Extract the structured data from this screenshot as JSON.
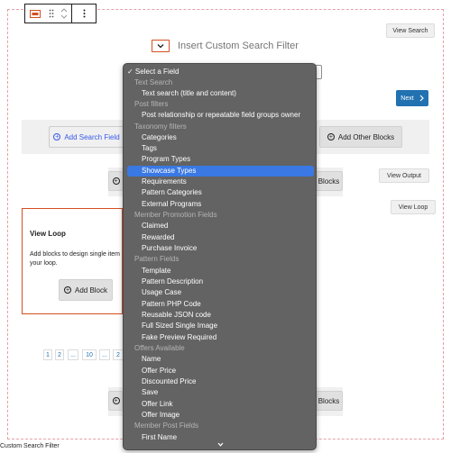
{
  "toolbar": {
    "block_icon": "custom-search-filter-icon",
    "drag_icon": "drag-handle-icon",
    "move_icon": "move-up-down-icon",
    "options_icon": "more-options-icon"
  },
  "header": {
    "title": "Insert Custom Search Filter",
    "collapse_icon": "chevron-down-icon"
  },
  "buttons": {
    "view_search": "View Search",
    "next": "Next",
    "view_output": "View Output",
    "view_loop": "View Loop",
    "add_search_field": "Add Search Field",
    "add_other_blocks": "Add Other Blocks",
    "blocks_fragment": "Blocks",
    "add_block": "Add Block"
  },
  "view_loop_panel": {
    "title": "View Loop",
    "description": "Add blocks to design single item in your loop.",
    "line1": "Add blocks to design single item",
    "line2": "your loop."
  },
  "pagination": [
    "1",
    "2",
    "...",
    "10",
    "...",
    "2"
  ],
  "footer": {
    "breadcrumb": "Custom Search Filter"
  },
  "dropdown": {
    "items": [
      {
        "type": "selected",
        "label": "✓ Select a Field"
      },
      {
        "type": "group",
        "label": "Text Search"
      },
      {
        "type": "option",
        "label": "Text search (title and content)"
      },
      {
        "type": "group",
        "label": "Post filters"
      },
      {
        "type": "option",
        "label": "Post relationship or repeatable field groups owner"
      },
      {
        "type": "group",
        "label": "Taxonomy filters"
      },
      {
        "type": "option",
        "label": "Categories"
      },
      {
        "type": "option",
        "label": "Tags"
      },
      {
        "type": "option",
        "label": "Program Types"
      },
      {
        "type": "highlight",
        "label": "Showcase Types"
      },
      {
        "type": "option",
        "label": "Requirements"
      },
      {
        "type": "option",
        "label": "Pattern Categories"
      },
      {
        "type": "option",
        "label": "External Programs"
      },
      {
        "type": "group",
        "label": "Member Promotion Fields"
      },
      {
        "type": "option",
        "label": "Claimed"
      },
      {
        "type": "option",
        "label": "Rewarded"
      },
      {
        "type": "option",
        "label": "Purchase Invoice"
      },
      {
        "type": "group",
        "label": "Pattern Fields"
      },
      {
        "type": "option",
        "label": "Template"
      },
      {
        "type": "option",
        "label": "Pattern Description"
      },
      {
        "type": "option",
        "label": "Usage Case"
      },
      {
        "type": "option",
        "label": "Pattern PHP Code"
      },
      {
        "type": "option",
        "label": "Reusable JSON code"
      },
      {
        "type": "option",
        "label": "Full Sized Single Image"
      },
      {
        "type": "option",
        "label": "Fake Preview Required"
      },
      {
        "type": "group",
        "label": "Offers Available"
      },
      {
        "type": "option",
        "label": "Name"
      },
      {
        "type": "option",
        "label": "Offer Price"
      },
      {
        "type": "option",
        "label": "Discounted Price"
      },
      {
        "type": "option",
        "label": "Save"
      },
      {
        "type": "option",
        "label": "Offer Link"
      },
      {
        "type": "option",
        "label": "Offer Image"
      },
      {
        "type": "group",
        "label": "Member Post Fields"
      },
      {
        "type": "option",
        "label": "First Name"
      }
    ],
    "scroll_icon": "chevron-down-icon"
  },
  "colors": {
    "accent_blue": "#3858e9",
    "next_blue": "#2271b1",
    "highlight": "#3a79e4",
    "menu_bg": "#636363",
    "selected_border": "#d54e21"
  }
}
